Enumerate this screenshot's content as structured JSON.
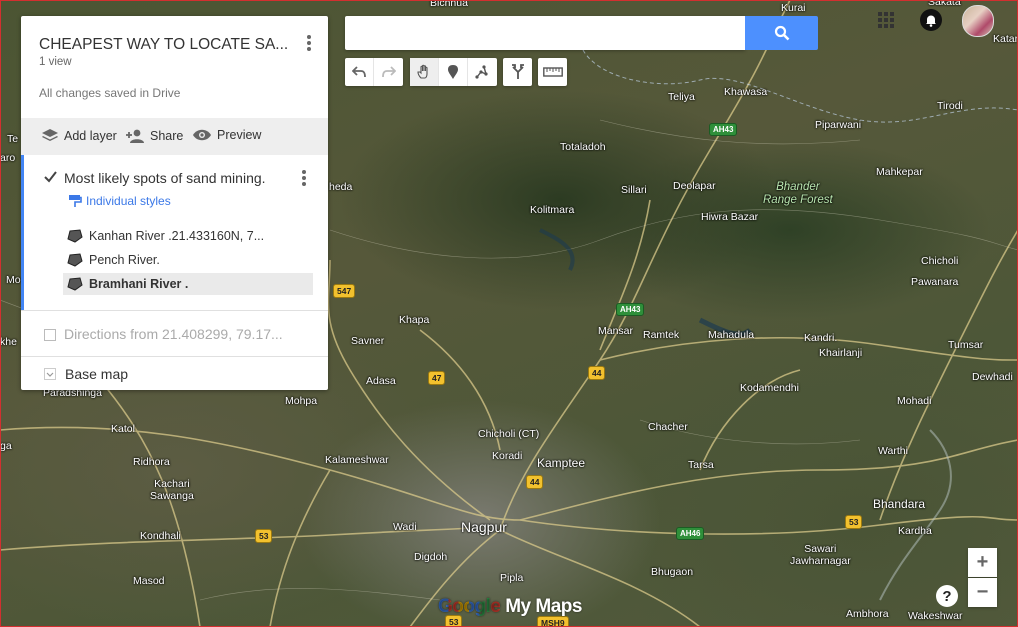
{
  "panel": {
    "map_title": "CHEAPEST WAY TO LOCATE SA...",
    "views": "1 view",
    "saved_status": "All changes saved in Drive",
    "actions": {
      "add_layer": "Add layer",
      "share": "Share",
      "preview": "Preview"
    },
    "layer": {
      "title": "Most likely spots of sand mining.",
      "checked": true,
      "styles_link": "Individual styles",
      "features": [
        {
          "label": "Kanhan River .21.433160N, 7...",
          "icon": "polygon-icon"
        },
        {
          "label": "Pench River.",
          "icon": "polygon-icon"
        },
        {
          "label": "Bramhani River .",
          "icon": "polygon-icon",
          "selected": true
        }
      ]
    },
    "directions_layer": {
      "title": "Directions from 21.408299, 79.17...",
      "checked": false
    },
    "base_map": "Base map"
  },
  "search": {
    "value": "",
    "placeholder": ""
  },
  "toolbar": [
    "undo-icon",
    "redo-icon",
    "hand-icon",
    "marker-icon",
    "draw-line-icon",
    "directions-icon",
    "ruler-icon"
  ],
  "colors": {
    "accent_blue": "#4285f4",
    "search_button": "#4d90fe",
    "link_blue": "#3b78e7"
  },
  "map": {
    "places": [
      {
        "name": "Bichhua",
        "cls": ""
      },
      {
        "name": "Kurai",
        "cls": ""
      },
      {
        "name": "Sakata",
        "cls": ""
      },
      {
        "name": "Katar",
        "cls": ""
      },
      {
        "name": "Teliya",
        "cls": ""
      },
      {
        "name": "Khawasa",
        "cls": ""
      },
      {
        "name": "Tirodi",
        "cls": ""
      },
      {
        "name": "Piparwani",
        "cls": ""
      },
      {
        "name": "Totaladoh",
        "cls": ""
      },
      {
        "name": "Mahkepar",
        "cls": ""
      },
      {
        "name": "Sillari",
        "cls": ""
      },
      {
        "name": "Deolapar",
        "cls": ""
      },
      {
        "name": "Bhander\nRange Forest",
        "cls": "forest"
      },
      {
        "name": "Kolitmara",
        "cls": ""
      },
      {
        "name": "Hiwra Bazar",
        "cls": ""
      },
      {
        "name": "Chicholi",
        "cls": ""
      },
      {
        "name": "Pawanara",
        "cls": ""
      },
      {
        "name": "Khapa",
        "cls": ""
      },
      {
        "name": "Mansar",
        "cls": ""
      },
      {
        "name": "Ramtek",
        "cls": ""
      },
      {
        "name": "Mahadula",
        "cls": ""
      },
      {
        "name": "Kandri.",
        "cls": ""
      },
      {
        "name": "Tumsar",
        "cls": ""
      },
      {
        "name": "Savner",
        "cls": ""
      },
      {
        "name": "Khairlanji",
        "cls": ""
      },
      {
        "name": "Dewhadi",
        "cls": ""
      },
      {
        "name": "Adasa",
        "cls": ""
      },
      {
        "name": "Kodamendhi",
        "cls": ""
      },
      {
        "name": "Paradshinga",
        "cls": ""
      },
      {
        "name": "Mohpa",
        "cls": ""
      },
      {
        "name": "Mohadi",
        "cls": ""
      },
      {
        "name": "Katol",
        "cls": ""
      },
      {
        "name": "Chicholi (CT)",
        "cls": ""
      },
      {
        "name": "Chacher",
        "cls": ""
      },
      {
        "name": "Warthi",
        "cls": ""
      },
      {
        "name": "Ridhora",
        "cls": ""
      },
      {
        "name": "Koradi",
        "cls": ""
      },
      {
        "name": "Kalameshwar",
        "cls": ""
      },
      {
        "name": "Kamptee",
        "cls": "med"
      },
      {
        "name": "Tarsa",
        "cls": ""
      },
      {
        "name": "Kachari\nSawanga",
        "cls": ""
      },
      {
        "name": "Bhandara",
        "cls": "med"
      },
      {
        "name": "Wadi",
        "cls": ""
      },
      {
        "name": "Nagpur",
        "cls": "big"
      },
      {
        "name": "Kardha",
        "cls": ""
      },
      {
        "name": "Kondhali",
        "cls": ""
      },
      {
        "name": "Digdoh",
        "cls": ""
      },
      {
        "name": "Sawari\nJawharnagar",
        "cls": ""
      },
      {
        "name": "Bhugaon",
        "cls": ""
      },
      {
        "name": "Masod",
        "cls": ""
      },
      {
        "name": "Pipla",
        "cls": ""
      },
      {
        "name": "Ambhora",
        "cls": ""
      },
      {
        "name": "Wakeshwar",
        "cls": ""
      },
      {
        "name": "Te",
        "cls": ""
      },
      {
        "name": "aro",
        "cls": ""
      },
      {
        "name": "heda",
        "cls": ""
      },
      {
        "name": "Mo",
        "cls": ""
      },
      {
        "name": "khe",
        "cls": ""
      },
      {
        "name": "ga",
        "cls": ""
      }
    ],
    "shields": [
      {
        "text": "AH43",
        "kind": "ah"
      },
      {
        "text": "547",
        "kind": "nh"
      },
      {
        "text": "AH43",
        "kind": "ah"
      },
      {
        "text": "47",
        "kind": "nh"
      },
      {
        "text": "44",
        "kind": "nh"
      },
      {
        "text": "44",
        "kind": "nh"
      },
      {
        "text": "53",
        "kind": "nh"
      },
      {
        "text": "53",
        "kind": "nh"
      },
      {
        "text": "AH46",
        "kind": "ah"
      },
      {
        "text": "53",
        "kind": "nh"
      },
      {
        "text": "MSH9",
        "kind": "nh"
      }
    ]
  },
  "branding": {
    "google": "Google",
    "mymaps": " My Maps"
  },
  "zoom": {
    "in": "+",
    "out": "−"
  },
  "help": "?"
}
